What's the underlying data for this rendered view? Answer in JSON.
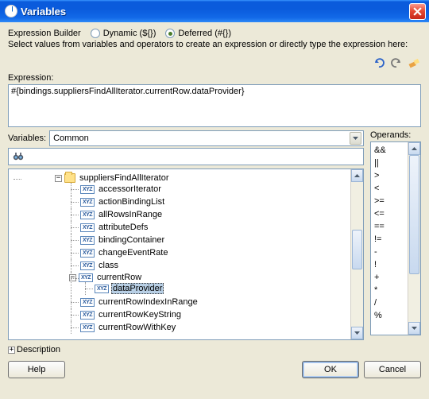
{
  "window": {
    "title": "Variables"
  },
  "builder": {
    "label": "Expression Builder",
    "dynamic_label": "Dynamic (${})",
    "deferred_label": "Deferred (#{})",
    "selected": "deferred",
    "hint": "Select values from variables and operators to create an expression or directly type the expression here:"
  },
  "toolbar": {
    "undo": "undo",
    "redo": "redo",
    "clear": "clear"
  },
  "expression": {
    "label": "Expression:",
    "value": "#{bindings.suppliersFindAllIterator.currentRow.dataProvider}"
  },
  "variables": {
    "label": "Variables:",
    "combo_value": "Common",
    "search": "",
    "tree": {
      "root": {
        "label": "suppliersFindAllIterator",
        "children": [
          {
            "label": "accessorIterator"
          },
          {
            "label": "actionBindingList"
          },
          {
            "label": "allRowsInRange"
          },
          {
            "label": "attributeDefs"
          },
          {
            "label": "bindingContainer"
          },
          {
            "label": "changeEventRate"
          },
          {
            "label": "class"
          },
          {
            "label": "currentRow",
            "expanded": true,
            "children": [
              {
                "label": "dataProvider",
                "selected": true
              }
            ]
          },
          {
            "label": "currentRowIndexInRange"
          },
          {
            "label": "currentRowKeyString"
          },
          {
            "label": "currentRowWithKey"
          }
        ]
      }
    }
  },
  "operands": {
    "label": "Operands:",
    "items": [
      "&&",
      "||",
      ">",
      "<",
      ">=",
      "<=",
      "==",
      "!=",
      "-",
      "!",
      "+",
      "*",
      "/",
      "%"
    ]
  },
  "description": {
    "label": "Description"
  },
  "buttons": {
    "help": "Help",
    "ok": "OK",
    "cancel": "Cancel"
  }
}
